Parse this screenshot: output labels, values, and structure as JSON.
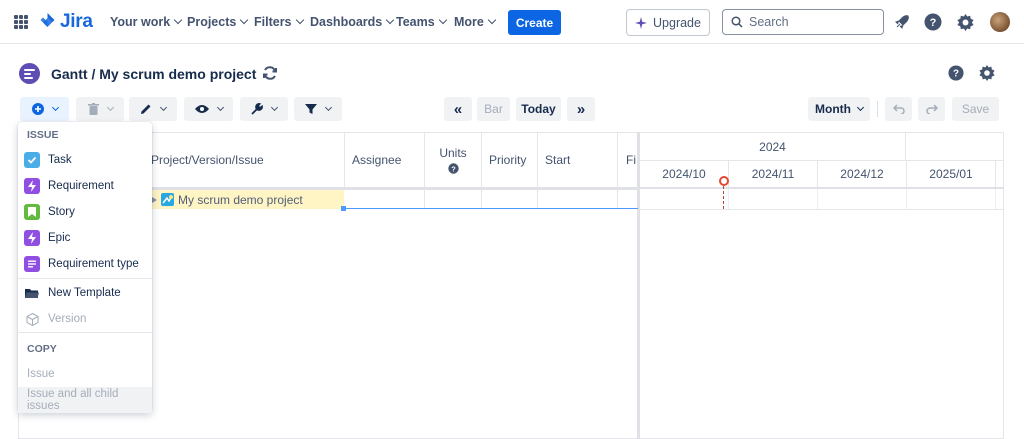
{
  "nav": {
    "product": "Jira",
    "items": [
      "Your work",
      "Projects",
      "Filters",
      "Dashboards",
      "Teams",
      "More"
    ],
    "create_label": "Create",
    "upgrade_label": "Upgrade",
    "search_placeholder": "Search"
  },
  "page": {
    "title": "Gantt / My scrum demo project"
  },
  "toolbar": {
    "nav_back": "«",
    "bar_label": "Bar",
    "today_label": "Today",
    "nav_forward": "»",
    "scale_label": "Month",
    "save_label": "Save"
  },
  "grid": {
    "columns": [
      "Project/Version/Issue",
      "Assignee",
      "Units",
      "Priority",
      "Start",
      "Fi"
    ],
    "rows": [
      {
        "name": "My scrum demo project"
      }
    ]
  },
  "timeline": {
    "year": "2024",
    "months": [
      "2024/10",
      "2024/11",
      "2024/12",
      "2025/01"
    ]
  },
  "menu": {
    "issue_section": "ISSUE",
    "issue_items": [
      {
        "label": "Task",
        "icon": "task-icon",
        "color": "#4bade8"
      },
      {
        "label": "Requirement",
        "icon": "requirement-icon",
        "color": "#904ee2"
      },
      {
        "label": "Story",
        "icon": "story-icon",
        "color": "#63ba3c"
      },
      {
        "label": "Epic",
        "icon": "epic-icon",
        "color": "#904ee2"
      },
      {
        "label": "Requirement type",
        "icon": "requirement-type-icon",
        "color": "#904ee2"
      }
    ],
    "new_template": "New Template",
    "version": "Version",
    "copy_section": "COPY",
    "copy_items": [
      "Issue",
      "Issue and all child issues"
    ]
  },
  "colors": {
    "primary": "#0c66e4",
    "project_row_highlight": "#fff4c4",
    "today_marker": "#e34935"
  }
}
